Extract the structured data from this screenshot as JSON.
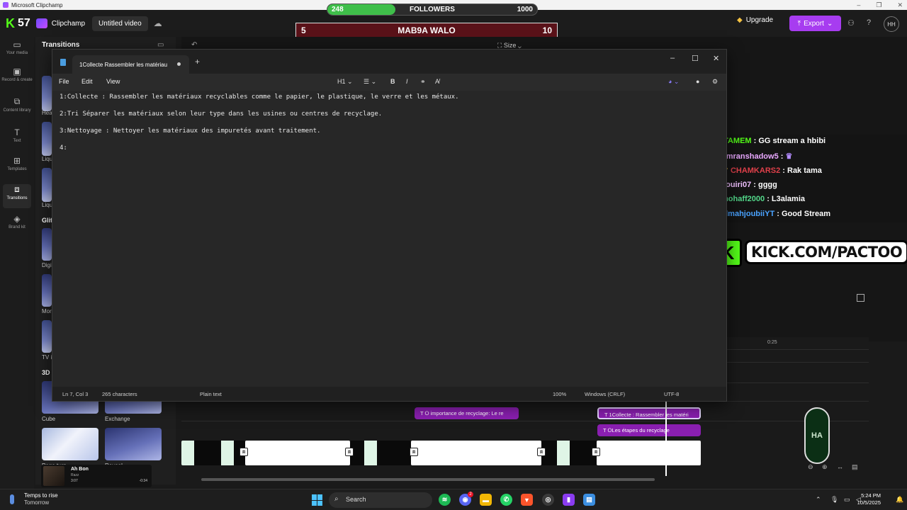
{
  "os": {
    "window_title": "Microsoft Clipchamp"
  },
  "header": {
    "kick_count": "57",
    "app_name": "Clipchamp",
    "project_name": "Untitled video",
    "upgrade_label": "Upgrade",
    "export_label": "Export",
    "avatar_initials": "HH"
  },
  "followers": {
    "current": "248",
    "label": "FOLLOWERS",
    "goal": "1000",
    "progress_fraction": 0.248
  },
  "score": {
    "left": "5",
    "title": "MAB9A WALO",
    "right": "10"
  },
  "left_nav": [
    {
      "label": "Your media",
      "icon": "folder-icon"
    },
    {
      "label": "Record & create",
      "icon": "camera-icon"
    },
    {
      "label": "Content library",
      "icon": "library-icon"
    },
    {
      "label": "Text",
      "icon": "text-icon"
    },
    {
      "label": "Templates",
      "icon": "templates-icon"
    },
    {
      "label": "Transitions",
      "icon": "transitions-icon"
    },
    {
      "label": "Brand kit",
      "icon": "brand-kit-icon"
    }
  ],
  "transitions_panel": {
    "title": "Transitions",
    "sections": {
      "glitch": "Glit",
      "three_d": "3D"
    },
    "labels": [
      "Hea",
      "Liqu",
      "Liqu",
      "Digi",
      "Mor",
      "TV i",
      "Cube",
      "Exchange",
      "Page turn",
      "Reveal"
    ]
  },
  "preview": {
    "size_label": "Size"
  },
  "notepad": {
    "tab_title": "1Collecte  Rassembler les matériau",
    "menus": [
      "File",
      "Edit",
      "View"
    ],
    "heading_label": "H1",
    "lines": [
      "1:Collecte : Rassembler les matériaux recyclables comme le papier, le plastique, le verre et les métaux.",
      "2:Tri Séparer les matériaux selon leur type dans les usines ou centres de recyclage.",
      "3:Nettoyage : Nettoyer les matériaux des impuretés avant traitement.",
      "4:"
    ],
    "status": {
      "position": "Ln 7, Col 3",
      "chars": "265 characters",
      "format": "Plain text",
      "zoom": "100%",
      "line_endings": "Windows (CRLF)",
      "encoding": "UTF-8"
    }
  },
  "chat": [
    {
      "user": "ITAMEM",
      "msg": "GG stream a hbibi",
      "color": "#53fc18"
    },
    {
      "user": "omranshadow5",
      "msg": "",
      "color": "#e9a8ff"
    },
    {
      "user": "CHAMKARS2",
      "msg": "Rak tama",
      "color": "#e0404a"
    },
    {
      "user": "souiri07",
      "msg": "gggg",
      "color": "#f0c0ff"
    },
    {
      "user": "mohaff2000",
      "msg": "L3alamia",
      "color": "#53d88a"
    },
    {
      "user": "elmahjoubiiYT",
      "msg": "Good Stream",
      "color": "#4aa3ff"
    }
  ],
  "kick_banner": {
    "k": "K",
    "text": "KICK.COM/PACTOO"
  },
  "timeline": {
    "time_marker": "0:25",
    "clips": [
      "importance de recyclage: Le re",
      "1Collecte : Rassembler les matéri",
      "Les étapes du recyclage"
    ],
    "emblem_text": "HA"
  },
  "player": {
    "song": "Ah Bon",
    "artist": "Razz",
    "elapsed": "3:07",
    "remaining": "-0:34"
  },
  "taskbar": {
    "weather_title": "Temps to rise",
    "weather_sub": "Tomorrow",
    "search_placeholder": "Search",
    "time": "5:24 PM",
    "date": "10/5/2025",
    "discord_badge": "2"
  }
}
